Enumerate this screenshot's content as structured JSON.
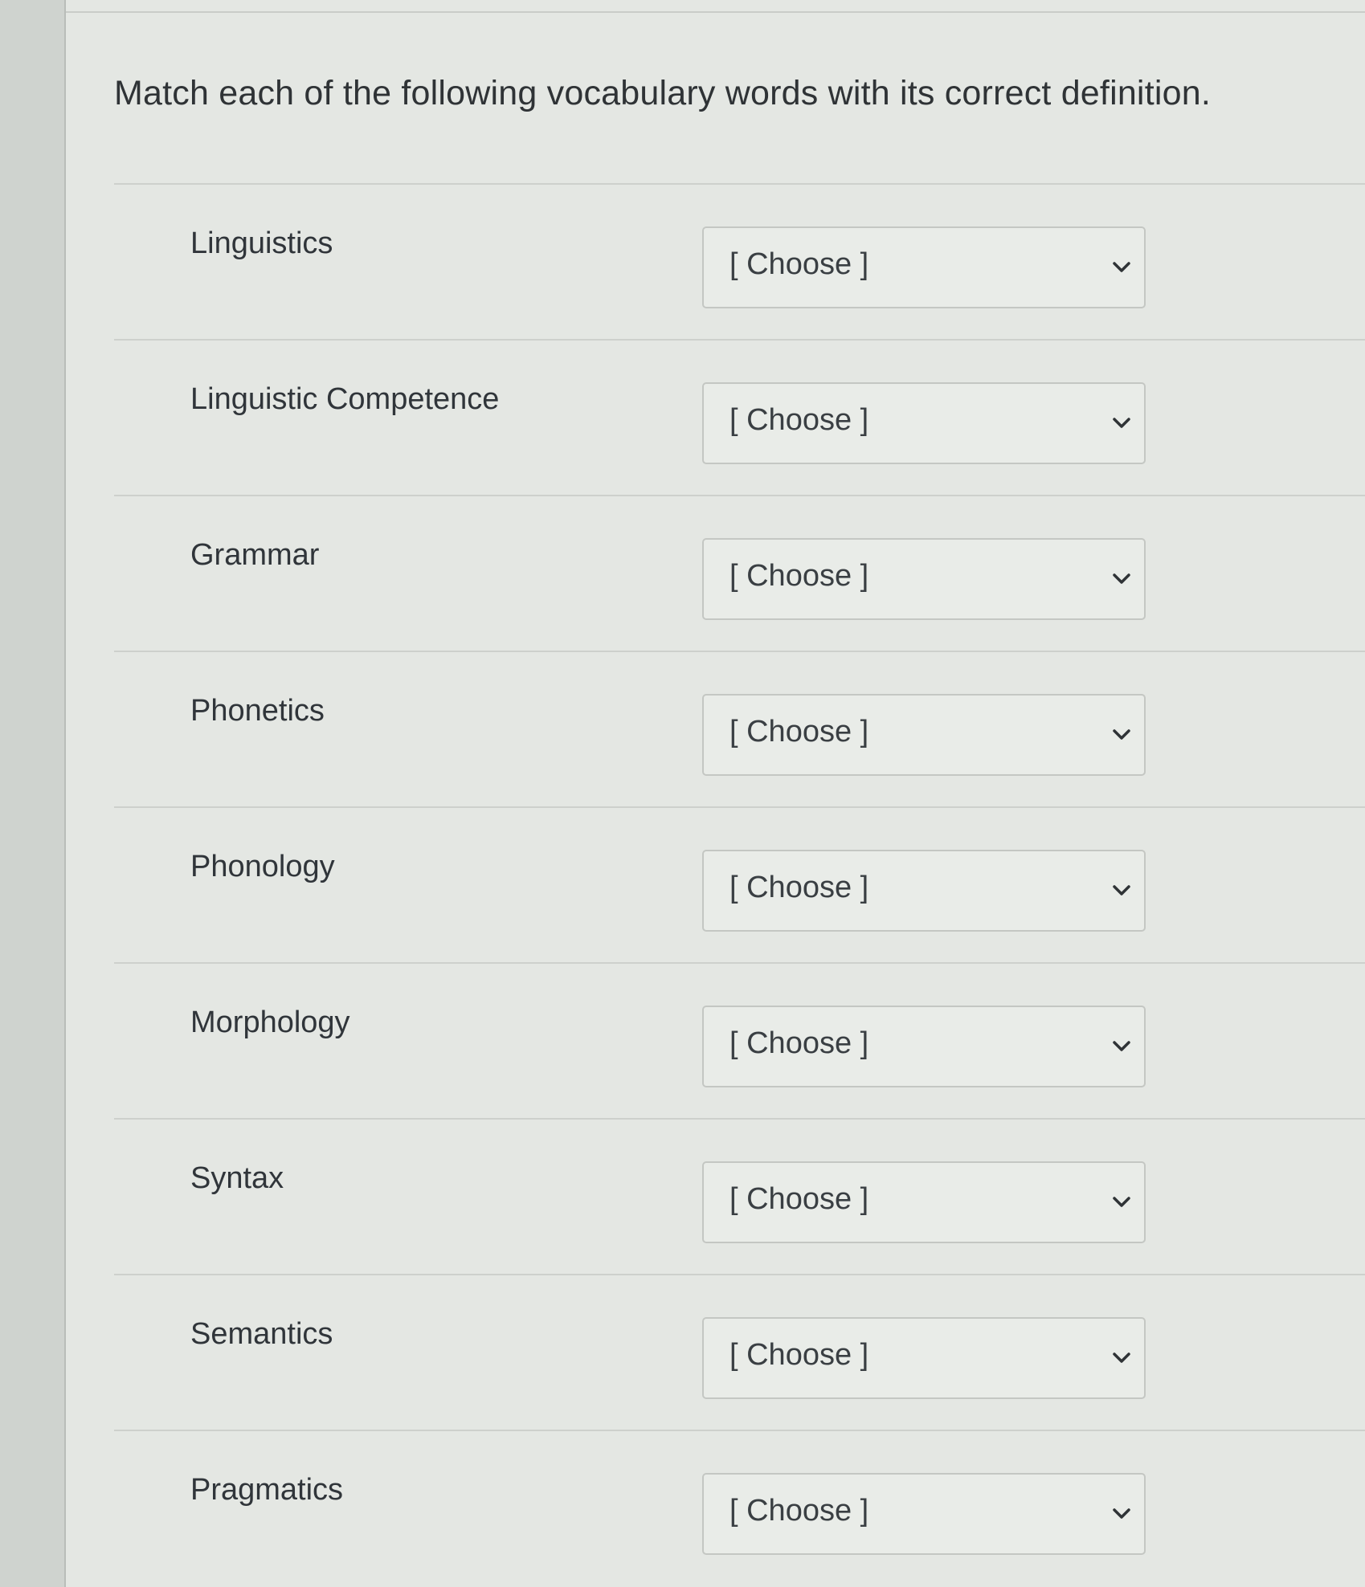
{
  "question": "Match each of the following vocabulary words with its correct definition.",
  "items": [
    {
      "term": "Linguistics",
      "selected": "[ Choose ]"
    },
    {
      "term": "Linguistic Competence",
      "selected": "[ Choose ]"
    },
    {
      "term": "Grammar",
      "selected": "[ Choose ]"
    },
    {
      "term": "Phonetics",
      "selected": "[ Choose ]"
    },
    {
      "term": "Phonology",
      "selected": "[ Choose ]"
    },
    {
      "term": "Morphology",
      "selected": "[ Choose ]"
    },
    {
      "term": "Syntax",
      "selected": "[ Choose ]"
    },
    {
      "term": "Semantics",
      "selected": "[ Choose ]"
    },
    {
      "term": "Pragmatics",
      "selected": "[ Choose ]"
    }
  ],
  "icons": {
    "dropdown": "chevron-down-icon"
  },
  "colors": {
    "text": "#2f3336",
    "border": "#c4c7c3",
    "background": "#e4e7e3"
  }
}
